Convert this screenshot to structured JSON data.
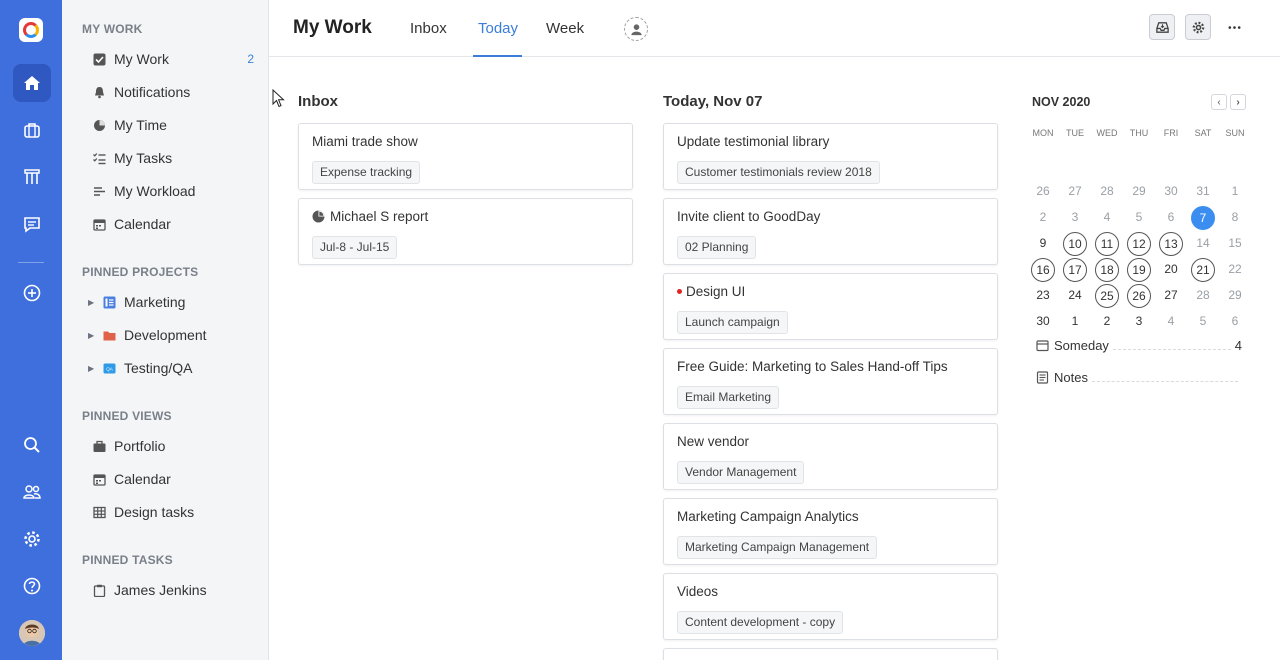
{
  "colors": {
    "rail": "#3f6fdc",
    "accent": "#3b7dd8",
    "today": "#3b8ef0",
    "dot": "#e02424"
  },
  "rail": {
    "icons": [
      "home-icon",
      "briefcase-icon",
      "ruler-icon",
      "chat-icon",
      "plus-circle-icon",
      "search-icon",
      "users-icon",
      "gear-icon",
      "help-icon"
    ]
  },
  "sidebar": {
    "my_work_title": "MY WORK",
    "my_work_items": [
      {
        "label": "My Work",
        "icon": "checkbox-icon",
        "count": "2"
      },
      {
        "label": "Notifications",
        "icon": "bell-icon"
      },
      {
        "label": "My Time",
        "icon": "clock-icon"
      },
      {
        "label": "My Tasks",
        "icon": "tasks-list-icon"
      },
      {
        "label": "My Workload",
        "icon": "workload-icon"
      },
      {
        "label": "Calendar",
        "icon": "calendar-icon"
      }
    ],
    "pinned_projects_title": "PINNED PROJECTS",
    "pinned_projects": [
      {
        "label": "Marketing",
        "icon": "board-icon"
      },
      {
        "label": "Development",
        "icon": "folder-icon"
      },
      {
        "label": "Testing/QA",
        "icon": "qa-icon"
      }
    ],
    "pinned_views_title": "PINNED VIEWS",
    "pinned_views": [
      {
        "label": "Portfolio",
        "icon": "briefcase-icon"
      },
      {
        "label": "Calendar",
        "icon": "calendar-icon"
      },
      {
        "label": "Design tasks",
        "icon": "table-icon"
      }
    ],
    "pinned_tasks_title": "PINNED TASKS",
    "pinned_tasks": [
      {
        "label": "James Jenkins",
        "icon": "clipboard-icon"
      }
    ]
  },
  "header": {
    "title": "My Work",
    "tabs": [
      "Inbox",
      "Today",
      "Week"
    ],
    "active_tab": "Today"
  },
  "inbox": {
    "title": "Inbox",
    "cards": [
      {
        "title": "Miami trade show",
        "tag": "Expense tracking"
      },
      {
        "title": "Michael S report",
        "tag": "Jul-8 - Jul-15",
        "icon": "pie-icon"
      }
    ]
  },
  "today": {
    "title": "Today, Nov 07",
    "cards": [
      {
        "title": "Update testimonial library",
        "tag": "Customer testimonials review 2018"
      },
      {
        "title": "Invite client to GoodDay",
        "tag": "02 Planning"
      },
      {
        "title": "Design UI",
        "tag": "Launch campaign",
        "priority_dot": true
      },
      {
        "title": "Free Guide: Marketing to Sales Hand-off Tips",
        "tag": "Email Marketing"
      },
      {
        "title": "New vendor",
        "tag": "Vendor Management"
      },
      {
        "title": "Marketing Campaign Analytics",
        "tag": "Marketing Campaign Management"
      },
      {
        "title": "Videos",
        "tag": "Content development - copy"
      }
    ]
  },
  "calendar": {
    "month": "NOV 2020",
    "weekdays": [
      "MON",
      "TUE",
      "WED",
      "THU",
      "FRI",
      "SAT",
      "SUN"
    ],
    "weeks": [
      [
        "26",
        "27",
        "28",
        "29",
        "30",
        "31",
        "1"
      ],
      [
        "2",
        "3",
        "4",
        "5",
        "6",
        "7",
        "8"
      ],
      [
        "9",
        "10",
        "11",
        "12",
        "13",
        "14",
        "15"
      ],
      [
        "16",
        "17",
        "18",
        "19",
        "20",
        "21",
        "22"
      ],
      [
        "23",
        "24",
        "25",
        "26",
        "27",
        "28",
        "29"
      ],
      [
        "30",
        "1",
        "2",
        "3",
        "4",
        "5",
        "6"
      ]
    ],
    "muted": [
      [
        0,
        0
      ],
      [
        0,
        1
      ],
      [
        0,
        2
      ],
      [
        0,
        3
      ],
      [
        0,
        4
      ],
      [
        0,
        5
      ],
      [
        0,
        6
      ],
      [
        1,
        0
      ],
      [
        1,
        1
      ],
      [
        1,
        2
      ],
      [
        1,
        3
      ],
      [
        1,
        4
      ],
      [
        1,
        6
      ],
      [
        2,
        5
      ],
      [
        2,
        6
      ],
      [
        3,
        6
      ],
      [
        4,
        5
      ],
      [
        4,
        6
      ],
      [
        5,
        4
      ],
      [
        5,
        5
      ],
      [
        5,
        6
      ]
    ],
    "ringed": [
      [
        2,
        1
      ],
      [
        2,
        2
      ],
      [
        2,
        3
      ],
      [
        2,
        4
      ],
      [
        3,
        0
      ],
      [
        3,
        1
      ],
      [
        3,
        2
      ],
      [
        3,
        3
      ],
      [
        3,
        5
      ],
      [
        4,
        2
      ],
      [
        4,
        3
      ]
    ],
    "today": [
      1,
      5
    ]
  },
  "side": {
    "someday_label": "Someday",
    "someday_count": "4",
    "notes_label": "Notes"
  }
}
